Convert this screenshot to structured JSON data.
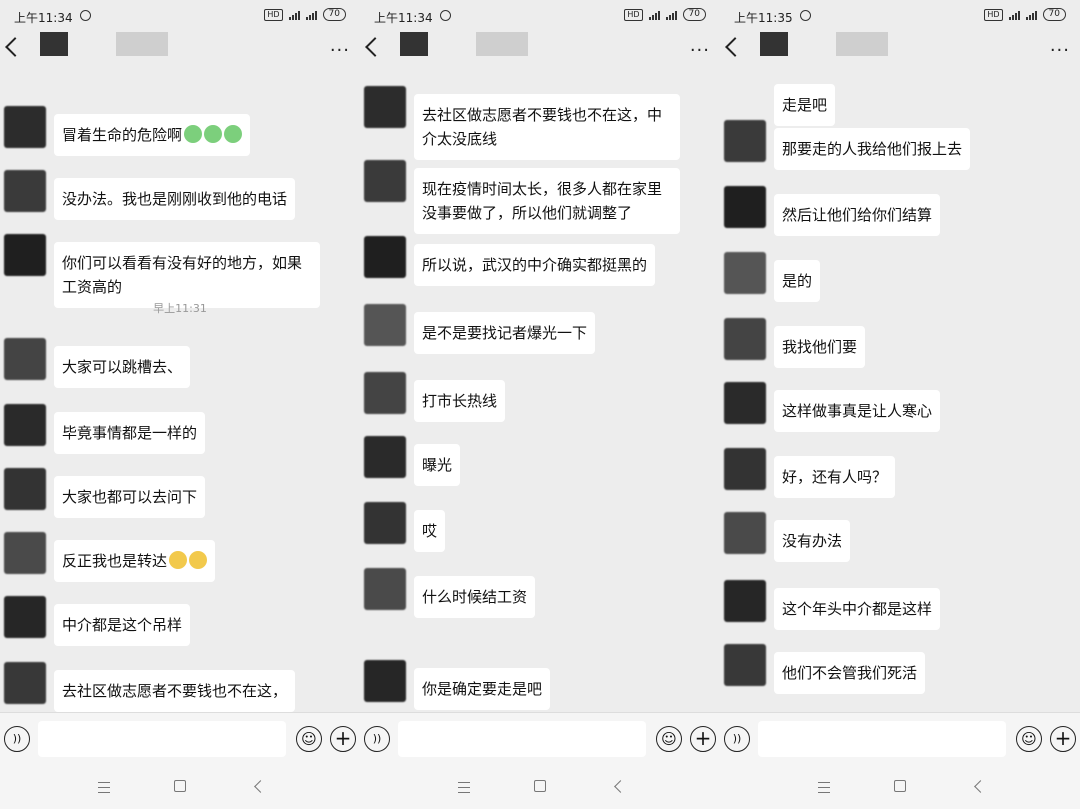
{
  "panels": [
    {
      "status_time": "上午11:34",
      "battery": "70",
      "messages": [
        {
          "type": "msg",
          "text": "冒着生命的危险啊",
          "emojis": 3,
          "emoji_color": "green"
        },
        {
          "type": "msg",
          "text": "没办法。我也是刚刚收到他的电话"
        },
        {
          "type": "msg",
          "text": "你们可以看看有没有好的地方，如果工资高的"
        },
        {
          "type": "time",
          "text": "早上11:31"
        },
        {
          "type": "msg",
          "text": "大家可以跳槽去、"
        },
        {
          "type": "msg",
          "text": "毕竟事情都是一样的"
        },
        {
          "type": "msg",
          "text": "大家也都可以去问下"
        },
        {
          "type": "msg",
          "text": "反正我也是转达",
          "emojis": 2,
          "emoji_color": "yellow"
        },
        {
          "type": "msg",
          "text": "中介都是这个吊样"
        },
        {
          "type": "msg",
          "text": "去社区做志愿者不要钱也不在这，"
        }
      ]
    },
    {
      "status_time": "上午11:34",
      "battery": "70",
      "messages": [
        {
          "type": "msg",
          "text": "去社区做志愿者不要钱也不在这，中介太没底线"
        },
        {
          "type": "msg",
          "text": "现在疫情时间太长，很多人都在家里没事要做了，所以他们就调整了"
        },
        {
          "type": "msg",
          "text": "所以说，武汉的中介确实都挺黑的"
        },
        {
          "type": "msg",
          "text": "是不是要找记者爆光一下"
        },
        {
          "type": "msg",
          "text": "打市长热线"
        },
        {
          "type": "msg",
          "text": "曝光"
        },
        {
          "type": "msg",
          "text": "哎"
        },
        {
          "type": "msg",
          "text": "什么时候结工资"
        },
        {
          "type": "msg",
          "text": "你是确定要走是吧",
          "quote": true
        }
      ]
    },
    {
      "status_time": "上午11:35",
      "battery": "70",
      "messages": [
        {
          "type": "msg",
          "text": "走是吧",
          "noavatar": true
        },
        {
          "type": "msg",
          "text": "那要走的人我给他们报上去"
        },
        {
          "type": "msg",
          "text": "然后让他们给你们结算"
        },
        {
          "type": "msg",
          "text": "是的"
        },
        {
          "type": "msg",
          "text": "我找他们要"
        },
        {
          "type": "msg",
          "text": "这样做事真是让人寒心"
        },
        {
          "type": "msg",
          "text": "好，还有人吗？"
        },
        {
          "type": "msg",
          "text": "没有办法"
        },
        {
          "type": "msg",
          "text": "这个年头中介都是这样"
        },
        {
          "type": "msg",
          "text": "他们不会管我们死活"
        }
      ]
    }
  ],
  "icons": {
    "voice": "voice-icon",
    "emoji": "emoji-icon",
    "plus": "plus-icon",
    "back": "back-icon",
    "more": "more-icon"
  },
  "colors": {
    "background": "#ededed",
    "bubble": "#ffffff",
    "timeline_text": "#999999"
  }
}
